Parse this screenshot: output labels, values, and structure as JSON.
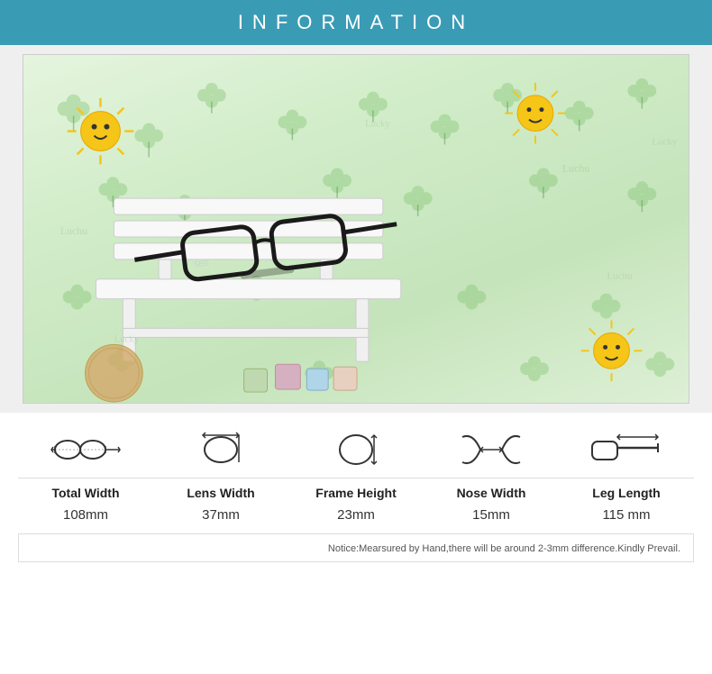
{
  "header": {
    "title": "INFORMATION",
    "background_color": "#3a9bb5"
  },
  "image": {
    "alt": "Children's glasses on a wooden bench with decorative background"
  },
  "measurements": [
    {
      "id": "total-width",
      "label": "Total Width",
      "value": "108mm",
      "icon": "total-width-icon"
    },
    {
      "id": "lens-width",
      "label": "Lens Width",
      "value": "37mm",
      "icon": "lens-width-icon"
    },
    {
      "id": "frame-height",
      "label": "Frame Height",
      "value": "23mm",
      "icon": "frame-height-icon"
    },
    {
      "id": "nose-width",
      "label": "Nose Width",
      "value": "15mm",
      "icon": "nose-width-icon"
    },
    {
      "id": "leg-length",
      "label": "Leg Length",
      "value": "115 mm",
      "icon": "leg-length-icon"
    }
  ],
  "notice": {
    "text": "Notice:Mearsured by Hand,there will be around 2-3mm difference.Kindly Prevail."
  }
}
